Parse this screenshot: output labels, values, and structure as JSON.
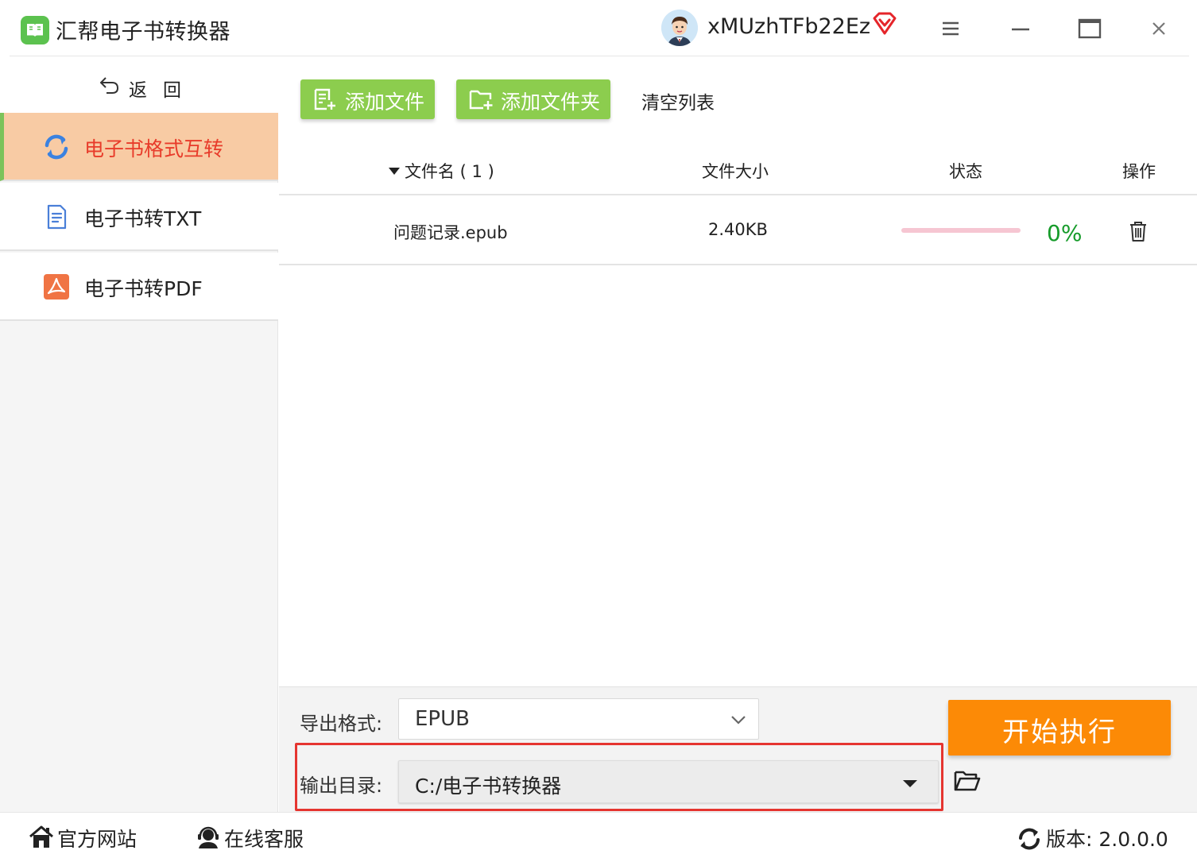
{
  "app": {
    "title": "汇帮电子书转换器",
    "logo_icon": "book-icon",
    "accent_color": "#8ccd4e"
  },
  "user": {
    "name": "xMUzhTFb22Ez",
    "avatar_icon": "user-avatar",
    "vip_icon": "vip-diamond-icon"
  },
  "window_controls": [
    "menu-icon",
    "minimize-icon",
    "maximize-icon",
    "close-icon"
  ],
  "sidebar": {
    "back_label": "返回",
    "items": [
      {
        "label": "电子书格式互转",
        "icon": "sync-icon",
        "active": true
      },
      {
        "label": "电子书转TXT",
        "icon": "document-icon",
        "active": false
      },
      {
        "label": "电子书转PDF",
        "icon": "pdf-icon",
        "active": false
      }
    ],
    "active_bg": "#f8cba4",
    "active_text_color": "#e83b2a"
  },
  "toolbar": {
    "add_file": "添加文件",
    "add_folder": "添加文件夹",
    "clear_list": "清空列表"
  },
  "table": {
    "columns": {
      "name": "文件名 ( 1 )",
      "size": "文件大小",
      "status": "状态",
      "action": "操作"
    },
    "rows": [
      {
        "name": "问题记录.epub",
        "size": "2.40KB",
        "progress": 0,
        "progress_label": "0%",
        "action_icon": "trash-icon"
      }
    ]
  },
  "settings": {
    "format_label": "导出格式:",
    "format_value": "EPUB",
    "output_label": "输出目录:",
    "output_value": "C:/电子书转换器",
    "folder_icon": "folder-open-icon",
    "start_button": "开始执行",
    "start_color": "#fc8a06",
    "highlight_color": "#e53530"
  },
  "footer": {
    "website": "官方网站",
    "support": "在线客服",
    "version": "版本:  2.0.0.0"
  }
}
